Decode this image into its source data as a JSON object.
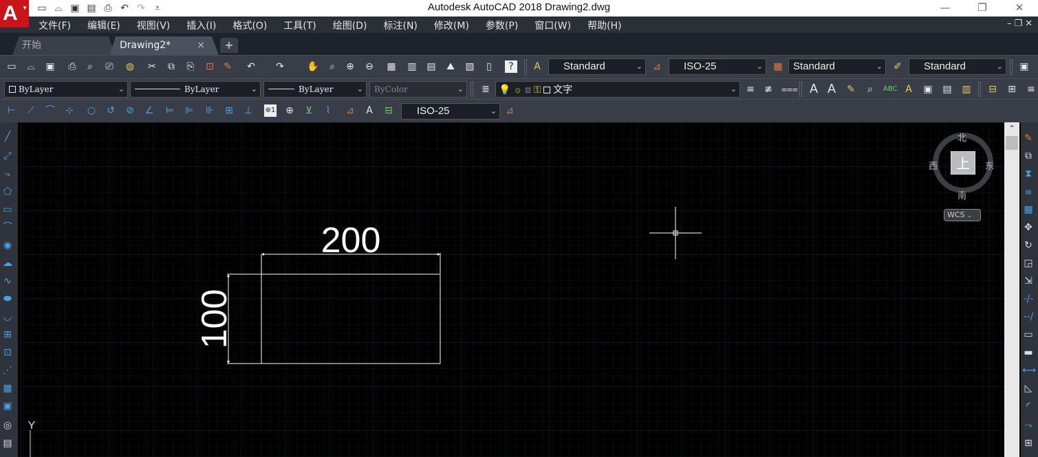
{
  "window": {
    "title": "Autodesk AutoCAD 2018    Drawing2.dwg",
    "controls": [
      "—",
      "❐",
      "✕"
    ]
  },
  "menu": {
    "items": [
      "文件(F)",
      "编辑(E)",
      "视图(V)",
      "插入(I)",
      "格式(O)",
      "工具(T)",
      "绘图(D)",
      "标注(N)",
      "修改(M)",
      "参数(P)",
      "窗口(W)",
      "帮助(H)"
    ],
    "right_controls": "–❐✕"
  },
  "tabs": {
    "start_label": "开始",
    "drawing_label": "Drawing2*",
    "close_glyph": "×",
    "add_glyph": "+"
  },
  "styles": {
    "text_style": "Standard",
    "dim_style": "ISO-25",
    "table_style": "Standard",
    "multileader_style": "Standard"
  },
  "properties": {
    "color": "ByLayer",
    "linetype": "ByLayer",
    "lineweight": "ByLayer",
    "plotstyle": "ByColor",
    "layer": "文字"
  },
  "dimension_toolbar": {
    "dim_style": "ISO-25"
  },
  "viewcube": {
    "north": "北",
    "south": "南",
    "west": "西",
    "east": "东",
    "top_face": "上",
    "wcs_label": "WCS"
  },
  "drawing": {
    "dim_horizontal": "200",
    "dim_vertical": "100",
    "ucs_y_label": "Y"
  },
  "colors": {
    "logo_red": "#c8151c",
    "canvas_bg": "#000000",
    "toolbar_bg": "#383d47",
    "menubar_bg": "#2b2f38",
    "geometry": "#ffffff"
  }
}
